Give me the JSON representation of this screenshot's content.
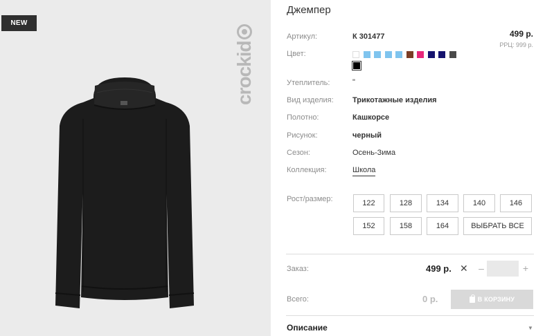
{
  "photo": {
    "badge": "NEW",
    "brand": "crockid"
  },
  "product": {
    "title": "Джемпер",
    "price": "499 р.",
    "rrp": "РРЦ: 999 р.",
    "colors": [
      "#ffffff",
      "#7fc4ee",
      "#7fc4ee",
      "#7fc4ee",
      "#7fc4ee",
      "#7a3d25",
      "#e8277a",
      "#15136e",
      "#15136e",
      "#4a4a4a",
      "#000000"
    ],
    "selected_color": "#000000"
  },
  "specs": {
    "article_label": "Артикул:",
    "article_value": "К 301477",
    "color_label": "Цвет:",
    "insulation_label": "Утеплитель:",
    "insulation_value": "\"",
    "type_label": "Вид изделия:",
    "type_value": "Трикотажные изделия",
    "fabric_label": "Полотно:",
    "fabric_value": "Кашкорсе",
    "pattern_label": "Рисунок:",
    "pattern_value": "черный",
    "season_label": "Сезон:",
    "season_value": "Осень-Зима",
    "collection_label": "Коллекция:",
    "collection_value": "Школа"
  },
  "sizes": {
    "label": "Рост/размер:",
    "items": [
      "122",
      "128",
      "134",
      "140",
      "146",
      "152",
      "158",
      "164"
    ],
    "select_all": "ВЫБРАТЬ ВСЕ"
  },
  "order": {
    "label": "Заказ:",
    "price": "499 р.",
    "times": "✕",
    "minus": "–",
    "plus": "+",
    "qty": ""
  },
  "total": {
    "label": "Всего:",
    "value": "0 р.",
    "cart_button": "В КОРЗИНУ"
  },
  "description": {
    "title": "Описание",
    "caret": "▼"
  }
}
